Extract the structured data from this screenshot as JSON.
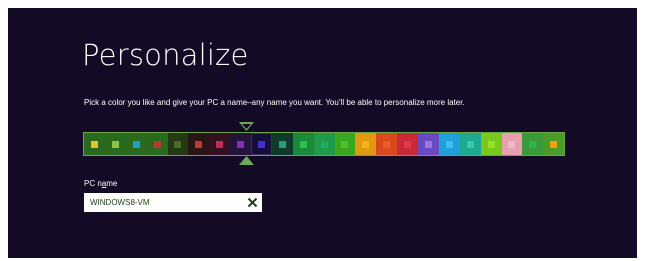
{
  "page": {
    "title": "Personalize",
    "description": "Pick a color you like and give your PC a name–any name you want. You’ll be able to personalize more later."
  },
  "color_picker": {
    "selected_index": 8,
    "marker_color": "#6fa95a",
    "swatches": [
      {
        "bg": "#2a6a1e",
        "chip": "#e8c21c"
      },
      {
        "bg": "#2a6a1e",
        "chip": "#8bc34a"
      },
      {
        "bg": "#2a6a1e",
        "chip": "#1f9fd1"
      },
      {
        "bg": "#2a6a1e",
        "chip": "#b93a2a"
      },
      {
        "bg": "#243a14",
        "chip": "#4e6a24"
      },
      {
        "bg": "#2a1414",
        "chip": "#c0392b"
      },
      {
        "bg": "#331022",
        "chip": "#c32a5a"
      },
      {
        "bg": "#22143a",
        "chip": "#8a2ab8"
      },
      {
        "bg": "#160e3a",
        "chip": "#4a2ad6"
      },
      {
        "bg": "#0e3a2c",
        "chip": "#1fa27a"
      },
      {
        "bg": "#1a8a3a",
        "chip": "#2ac24a"
      },
      {
        "bg": "#1f9a4a",
        "chip": "#1faa6a"
      },
      {
        "bg": "#3aa81e",
        "chip": "#52c028"
      },
      {
        "bg": "#e09a12",
        "chip": "#f6b21a"
      },
      {
        "bg": "#d84a1e",
        "chip": "#f05a2a"
      },
      {
        "bg": "#c82a3a",
        "chip": "#e03a4a"
      },
      {
        "bg": "#6a4ac0",
        "chip": "#9a7ae0"
      },
      {
        "bg": "#1fa0d8",
        "chip": "#3ac0f0"
      },
      {
        "bg": "#1fa890",
        "chip": "#3ac8aa"
      },
      {
        "bg": "#7ac81e",
        "chip": "#9ae02a"
      },
      {
        "bg": "#e8a0b0",
        "chip": "#f0b8c8"
      },
      {
        "bg": "#3a9a3a",
        "chip": "#2ab84a"
      },
      {
        "bg": "#4a9a2a",
        "chip": "#f0a010"
      }
    ]
  },
  "pc_name": {
    "label": "PC name",
    "label_underlined_char": "a",
    "value": "WINDOWS8-VM",
    "placeholder": "",
    "clear_icon": "close-icon"
  },
  "colors": {
    "background": "#130b26",
    "text": "#ffffff",
    "input_text": "#1c3f12"
  }
}
